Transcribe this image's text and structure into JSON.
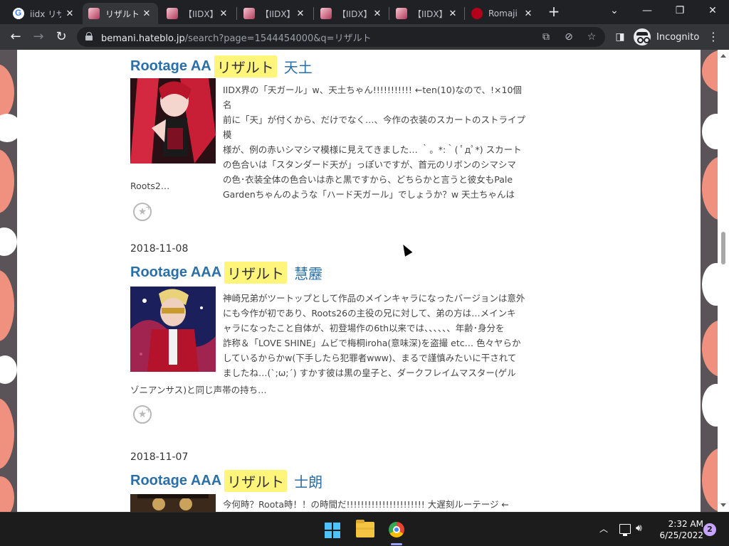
{
  "browser": {
    "tabs": [
      {
        "label": "iidx リザ",
        "favicon": "google-icon"
      },
      {
        "label": "リザルト",
        "favicon": "anime-icon",
        "active": true
      },
      {
        "label": "【IIDX】C",
        "favicon": "anime-icon"
      },
      {
        "label": "【IIDX】C",
        "favicon": "anime-icon"
      },
      {
        "label": "【IIDX】B",
        "favicon": "anime-icon"
      },
      {
        "label": "【IIDX】B",
        "favicon": "anime-icon"
      },
      {
        "label": "Romaji",
        "favicon": "red-circle-icon"
      }
    ],
    "url_host": "bemani.hateblo.jp",
    "url_path": "/search?page=1544454000&q=リザルト",
    "incognito_label": "Incognito"
  },
  "entries": [
    {
      "date": "",
      "title": "Rootage AA",
      "keyword": "リザルト",
      "subtitle": "天土",
      "excerpt_lines": [
        "IIDX界の「天ガール」w、天土ちゃん!!!!!!!!!!! ←ten(10)なので、!×10個 名",
        "前に「天」が付くから、だけでなく…、今作の衣装のスカートのストライプ模",
        "様が、例の赤いシマシマ模様に見えてきました… ｀。*:｀( ﾟдﾟ*) スカート",
        "の色合いは「スタンダード天が」っぽいですが、首元のリボンのシマシマ",
        "の色･衣装全体の色合いは赤と黒ですから、どちらかと言うと彼女もPale",
        "Gardenちゃんのような「ハード天ガール」でしょうか？w 天土ちゃんは"
      ],
      "excerpt_tail": "Roots2…"
    },
    {
      "date": "2018-11-08",
      "title": "Rootage AAA",
      "keyword": "リザルト",
      "subtitle": "慧靂",
      "excerpt_lines": [
        "神崎兄弟がツートップとして作品のメインキャラになったバージョンは意外",
        "にも今作が初であり、Roots26の主役の兄に対して、弟の方は…メインキ",
        "ャラになったこと自体が、初登場作の6th以来では、、、、、、年齢･身分を",
        "詐称＆「LOVE SHINE」ムビで梅桐iroha(意味深)を盗撮 etc… 色々ヤらか",
        "しているからかw(下手したら犯罪者www)、まるで謹慎みたいに干されて",
        "ましたね…(`;ω;´) すかす彼は黒の皇子と、ダークフレイムマスター(ゲル"
      ],
      "excerpt_tail": "ゾニアンサス)と同じ声帯の持ち…"
    },
    {
      "date": "2018-11-07",
      "title": "Rootage AAA",
      "keyword": "リザルト",
      "subtitle": "士朗",
      "excerpt_lines": [
        "今何時？Roota時！！の時間だ!!!!!!!!!!!!!!!!!!!!!! 大遅刻ルーテージ ←"
      ],
      "excerpt_tail": ""
    }
  ],
  "taskbar": {
    "time": "2:32 AM",
    "date": "6/25/2022",
    "notification_count": "2"
  }
}
